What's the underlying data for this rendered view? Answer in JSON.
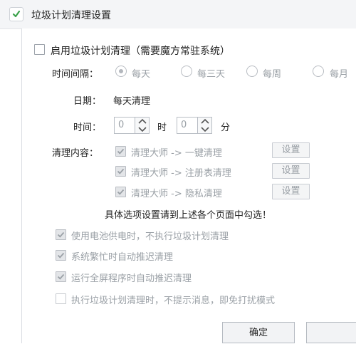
{
  "window": {
    "title": "垃圾计划清理设置"
  },
  "enable": {
    "label": "启用垃圾计划清理（需要魔方常驻系统）",
    "checked": false
  },
  "interval": {
    "label": "时间间隔：",
    "options": [
      "每天",
      "每三天",
      "每周",
      "每月"
    ],
    "selected": "每天"
  },
  "date": {
    "label": "日期：",
    "value": "每天清理"
  },
  "time": {
    "label": "时间：",
    "hour": "0",
    "hour_unit": "时",
    "minute": "0",
    "minute_unit": "分"
  },
  "content": {
    "label": "清理内容：",
    "items": [
      {
        "label": "清理大师 -> 一键清理",
        "checked": true,
        "button": "设置"
      },
      {
        "label": "清理大师 -> 注册表清理",
        "checked": true,
        "button": "设置"
      },
      {
        "label": "清理大师 -> 隐私清理",
        "checked": true,
        "button": "设置"
      }
    ],
    "hint": "具体选项设置请到上述各个页面中勾选！"
  },
  "options": [
    {
      "label": "使用电池供电时，不执行垃圾计划清理",
      "checked": true
    },
    {
      "label": "系统繁忙时自动推迟清理",
      "checked": true
    },
    {
      "label": "运行全屏程序时自动推迟清理",
      "checked": true
    },
    {
      "label": "执行垃圾计划清理时，不提示消息，即免打扰模式",
      "checked": false
    }
  ],
  "footer": {
    "ok_label": "确定"
  }
}
